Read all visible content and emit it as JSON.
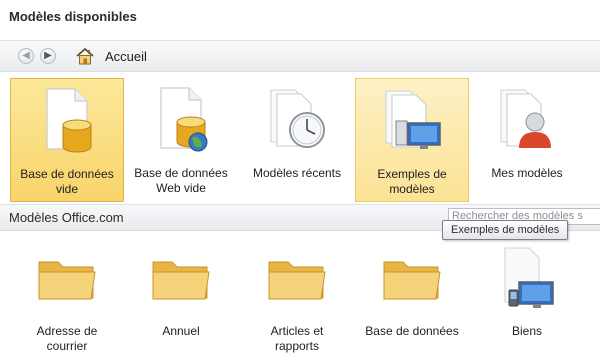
{
  "header": {
    "title": "Modèles disponibles"
  },
  "nav": {
    "breadcrumb": "Accueil"
  },
  "templates": {
    "blank_db": {
      "line1": "Base de données",
      "line2": "vide"
    },
    "blank_web_db": {
      "line1": "Base de données",
      "line2": "Web vide"
    },
    "recent": {
      "label": "Modèles récents"
    },
    "samples": {
      "line1": "Exemples de",
      "line2": "modèles"
    },
    "my_templates": {
      "label": "Mes modèles"
    }
  },
  "office_section": {
    "title": "Modèles Office.com",
    "search_placeholder": "Rechercher des modèles s",
    "items": [
      {
        "line1": "Adresse de",
        "line2": "courrier"
      },
      {
        "line1": "Annuel",
        "line2": ""
      },
      {
        "line1": "Articles et",
        "line2": "rapports"
      },
      {
        "line1": "Base de données",
        "line2": ""
      },
      {
        "line1": "Biens",
        "line2": ""
      }
    ]
  },
  "tooltip": {
    "text": "Exemples de modèles"
  },
  "colors": {
    "selected": "#f8d46a",
    "hovered": "#fbe295",
    "folder": "#f2c75c",
    "accent": "#3a78c4"
  }
}
